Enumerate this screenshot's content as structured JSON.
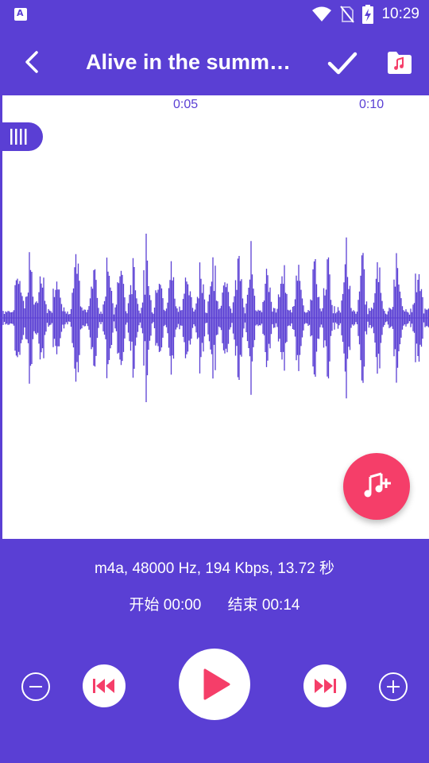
{
  "status_bar": {
    "time": "10:29",
    "icons": [
      "a-notification-icon",
      "wifi-icon",
      "no-sim-icon",
      "battery-charging-icon"
    ]
  },
  "app_bar": {
    "title": "Alive in the summ…",
    "back_icon": "back-arrow-icon",
    "confirm_icon": "check-icon",
    "folder_icon": "music-folder-icon"
  },
  "waveform": {
    "ticks": [
      "0:05",
      "0:10"
    ],
    "color": "#5a3fd4"
  },
  "file_info": "m4a, 48000 Hz, 194 Kbps, 13.72 秒",
  "range": {
    "start": "开始 00:00",
    "end": "结束 00:14"
  },
  "colors": {
    "primary": "#5a3fd4",
    "accent": "#f53e69",
    "background": "#ffffff"
  }
}
